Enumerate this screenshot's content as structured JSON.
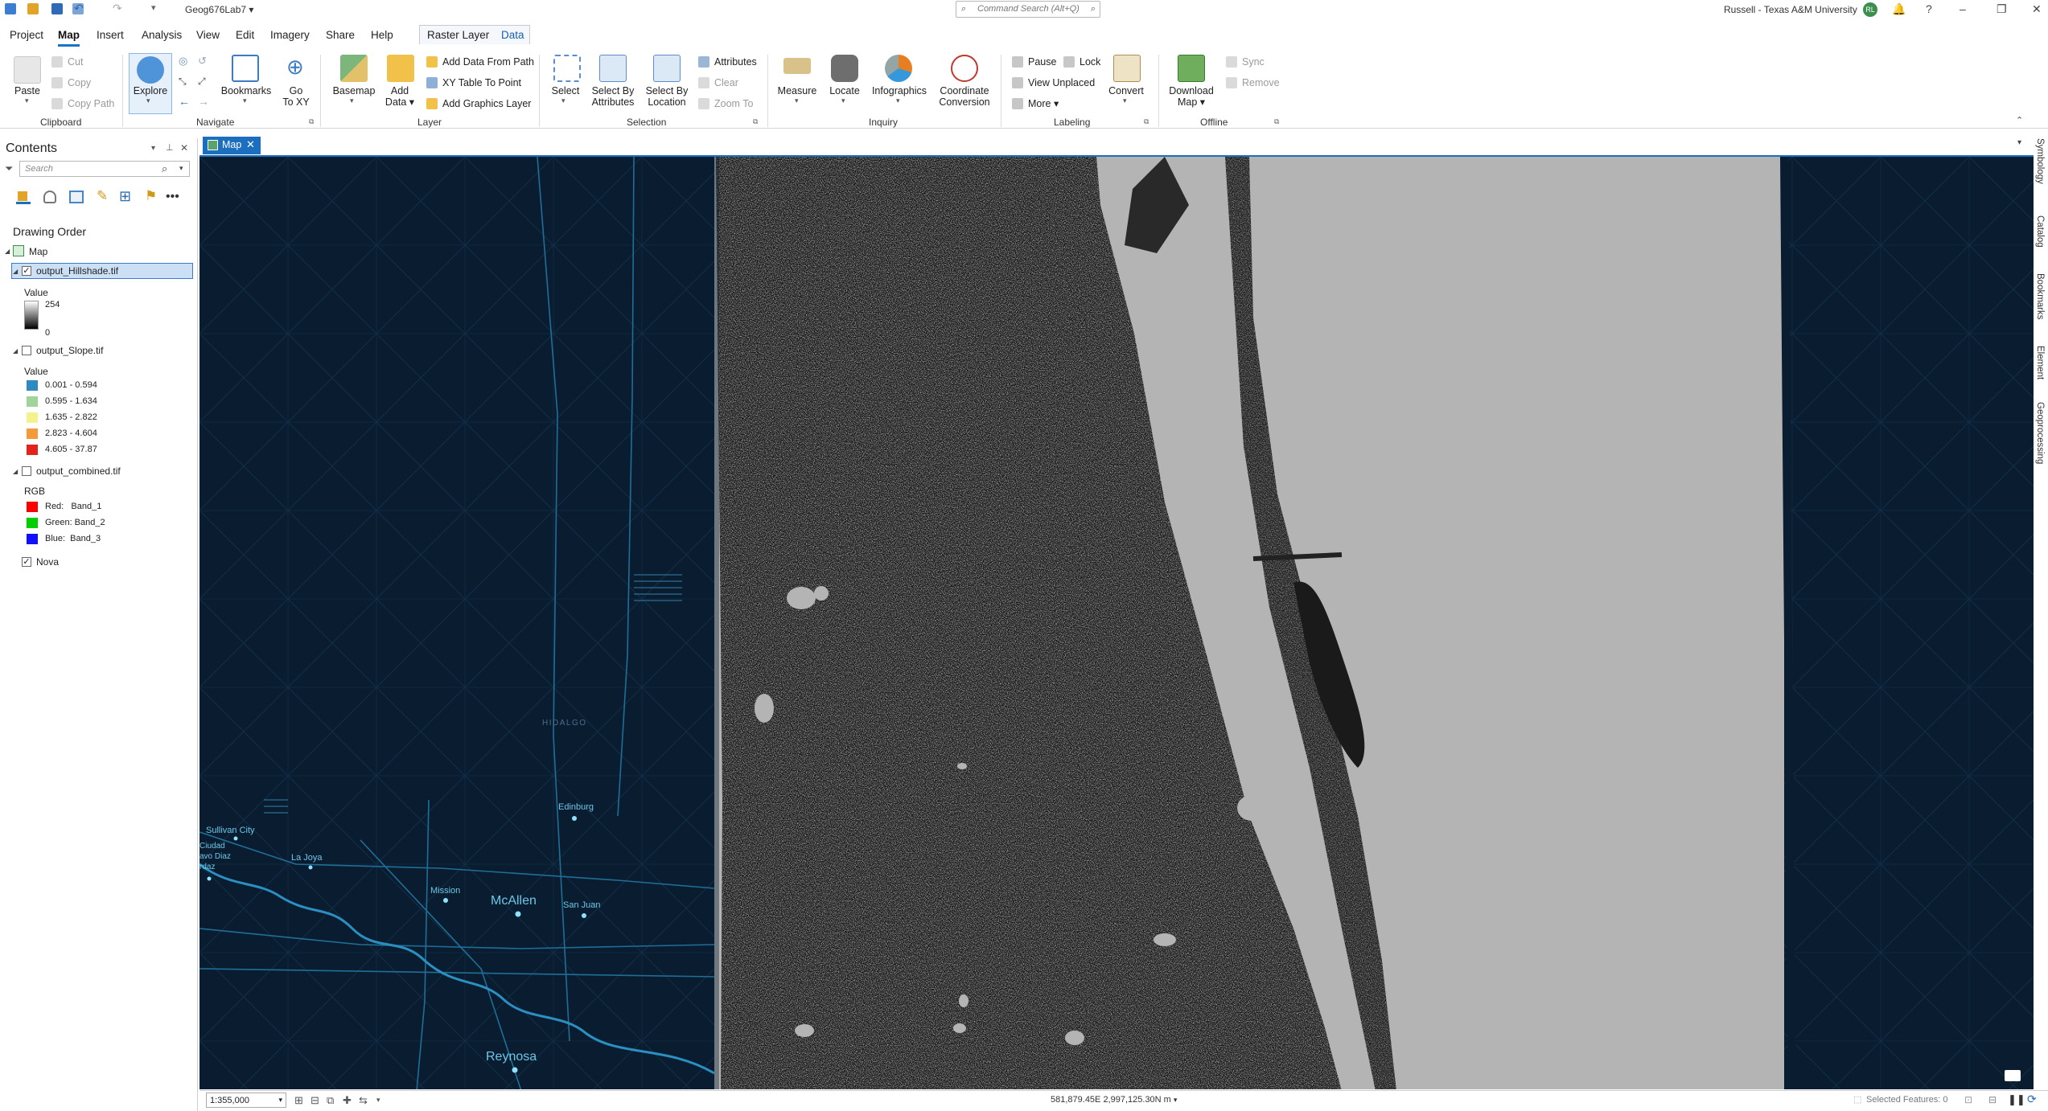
{
  "titlebar": {
    "project_name": "Geog676Lab7",
    "command_search_placeholder": "Command Search (Alt+Q)",
    "user": "Russell - Texas A&M University",
    "avatar_initials": "RL"
  },
  "menu": {
    "tabs": [
      "Project",
      "Map",
      "Insert",
      "Analysis",
      "View",
      "Edit",
      "Imagery",
      "Share",
      "Help"
    ],
    "active": "Map",
    "context_tabs": [
      "Raster Layer",
      "Data"
    ]
  },
  "ribbon": {
    "clipboard": {
      "paste": "Paste",
      "cut": "Cut",
      "copy": "Copy",
      "copy_path": "Copy Path",
      "group": "Clipboard"
    },
    "navigate": {
      "explore": "Explore",
      "bookmarks": "Bookmarks",
      "go_to_xy_1": "Go",
      "go_to_xy_2": "To XY",
      "group": "Navigate"
    },
    "layer": {
      "basemap": "Basemap",
      "add_data_1": "Add",
      "add_data_2": "Data",
      "add_data_from_path": "Add Data From Path",
      "xy_table_to_point": "XY Table To Point",
      "add_graphics_layer": "Add Graphics Layer",
      "group": "Layer"
    },
    "selection": {
      "select": "Select",
      "select_by_attributes_1": "Select By",
      "select_by_attributes_2": "Attributes",
      "select_by_location_1": "Select By",
      "select_by_location_2": "Location",
      "attributes": "Attributes",
      "clear": "Clear",
      "zoom_to": "Zoom To",
      "group": "Selection"
    },
    "inquiry": {
      "measure": "Measure",
      "locate": "Locate",
      "infographics": "Infographics",
      "coordinate_1": "Coordinate",
      "coordinate_2": "Conversion",
      "group": "Inquiry"
    },
    "labeling": {
      "pause": "Pause",
      "lock": "Lock",
      "view_unplaced": "View Unplaced",
      "more": "More",
      "convert": "Convert",
      "group": "Labeling"
    },
    "offline": {
      "download_1": "Download",
      "download_2": "Map",
      "sync": "Sync",
      "remove": "Remove",
      "group": "Offline"
    }
  },
  "contents": {
    "title": "Contents",
    "search_placeholder": "Search",
    "drawing_order": "Drawing Order",
    "map_label": "Map",
    "layers": {
      "hillshade": {
        "name": "output_Hillshade.tif",
        "value_label": "Value",
        "max": "254",
        "min": "0",
        "checked": true
      },
      "slope": {
        "name": "output_Slope.tif",
        "value_label": "Value",
        "checked": false,
        "classes": [
          {
            "label": "0.001 - 0.594",
            "color": "#2e8bc0"
          },
          {
            "label": "0.595 - 1.634",
            "color": "#9fd49a"
          },
          {
            "label": "1.635 - 2.822",
            "color": "#f4f28a"
          },
          {
            "label": "2.823 - 4.604",
            "color": "#f59a3a"
          },
          {
            "label": "4.605 - 37.87",
            "color": "#e3231c"
          }
        ]
      },
      "combined": {
        "name": "output_combined.tif",
        "rgb_label": "RGB",
        "checked": false,
        "bands": [
          {
            "label": "Red:   Band_1",
            "color": "#ff0000"
          },
          {
            "label": "Green: Band_2",
            "color": "#00d000"
          },
          {
            "label": "Blue:  Band_3",
            "color": "#1010ff"
          }
        ]
      },
      "basemap": {
        "name": "Nova",
        "checked": true
      }
    }
  },
  "map": {
    "tab_label": "Map",
    "places": {
      "hidalgo": "HIDALGO",
      "edinburg": "Edinburg",
      "sullivan_city": "Sullivan City",
      "ciudad_1": "Ciudad",
      "ciudad_2": "avo Diaz",
      "ciudad_3": "rdaz",
      "la_joya": "La Joya",
      "mission": "Mission",
      "mcallen": "McAllen",
      "san_juan": "San Juan",
      "reynosa": "Reynosa"
    }
  },
  "side_tabs": [
    "Symbology",
    "Catalog",
    "Bookmarks",
    "Element",
    "Geoprocessing"
  ],
  "status": {
    "scale": "1:355,000",
    "coordinates": "581,879.45E 2,997,125.30N m",
    "selected_features": "Selected Features: 0"
  },
  "colors": {
    "accent": "#1c6fbf",
    "map_background": "#0a1d30",
    "raster_land": "#1a1a1a",
    "raster_water": "#b4b4b4"
  }
}
